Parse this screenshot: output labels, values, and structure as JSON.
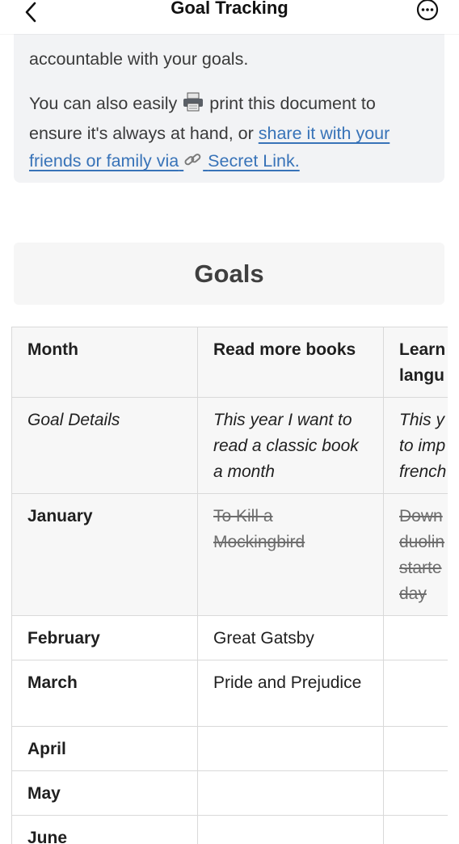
{
  "nav": {
    "title": "Goal Tracking",
    "back_icon": "chevron-left-icon",
    "more_icon": "more-circle-icon"
  },
  "callout": {
    "line_cut": "accountable with your goals.",
    "p1": "accountable with your goals.",
    "p2_before": "You can also easily",
    "p2_emoji": "🖨️",
    "p2_mid": "print this document to ensure it's always at hand, or",
    "p2_link": "share it with your friends or family via",
    "p2_link_emoji": "🔗",
    "p2_link_end": "Secret Link."
  },
  "goals_title": "Goals",
  "table": {
    "headers": [
      "Month",
      "Read more books",
      "Learn langu"
    ],
    "details": [
      "Goal Details",
      "This year I want to read a classic book a month",
      "This y to imp french"
    ],
    "rows": [
      {
        "month": "January",
        "c1": "To Kill a Mockingbird",
        "c2": "Down duolin starte day",
        "strike": true
      },
      {
        "month": "February",
        "c1": "Great Gatsby",
        "c2": "",
        "strike": false
      },
      {
        "month": "March",
        "c1": "Pride and Prejudice",
        "c2": "",
        "strike": false
      },
      {
        "month": "April",
        "c1": "",
        "c2": "",
        "strike": false
      },
      {
        "month": "May",
        "c1": "",
        "c2": "",
        "strike": false
      },
      {
        "month": "June",
        "c1": "",
        "c2": "",
        "strike": false
      }
    ]
  },
  "colors": {
    "link": "#3873b8",
    "callout_bg": "#f2f3f5",
    "border": "#d9d9d9"
  }
}
